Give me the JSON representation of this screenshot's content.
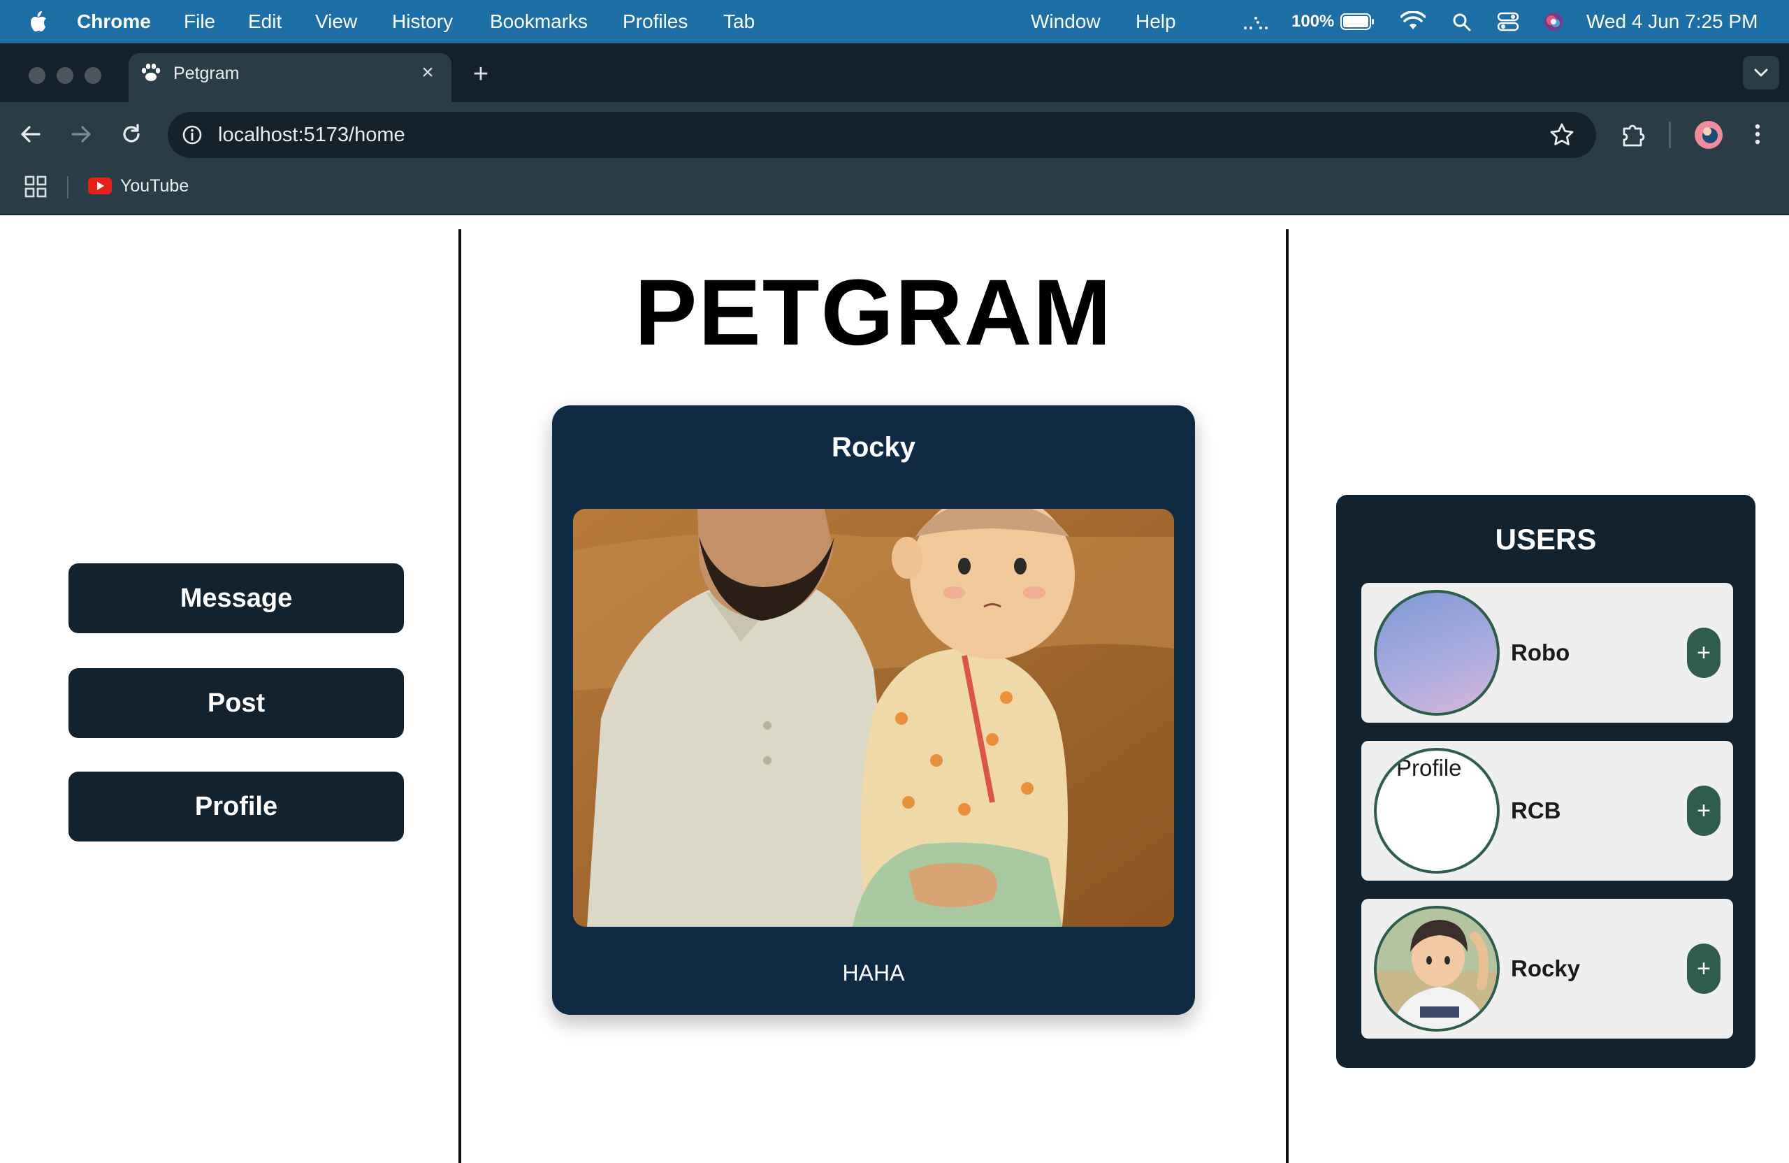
{
  "menubar": {
    "app_name": "Chrome",
    "menus": [
      "File",
      "Edit",
      "View",
      "History",
      "Bookmarks",
      "Profiles",
      "Tab"
    ],
    "right_menus": [
      "Window",
      "Help"
    ],
    "battery": "100%",
    "datetime": "Wed 4 Jun  7:25 PM"
  },
  "browser": {
    "tab_title": "Petgram",
    "tab_close": "×",
    "new_tab": "+",
    "url": "localhost:5173/home",
    "bookmarks": [
      {
        "label": "YouTube"
      }
    ]
  },
  "sidebar": {
    "buttons": [
      {
        "label": "Message"
      },
      {
        "label": "Post"
      },
      {
        "label": "Profile"
      }
    ]
  },
  "feed": {
    "brand": "PETGRAM",
    "post": {
      "username": "Rocky",
      "caption": "HAHA"
    }
  },
  "users": {
    "title": "USERS",
    "list": [
      {
        "name": "Robo",
        "avatar": "gradient-avatar",
        "action": "+"
      },
      {
        "name": "RCB",
        "avatar": "broken-image",
        "avatar_alt": "Profile",
        "action": "+"
      },
      {
        "name": "Rocky",
        "avatar": "anime-boy-avatar",
        "action": "+"
      }
    ]
  },
  "colors": {
    "menubar": "#1e6fa6",
    "nav_button": "#13222f",
    "post_card": "#112a44",
    "follow_button": "#2f5c4d"
  }
}
